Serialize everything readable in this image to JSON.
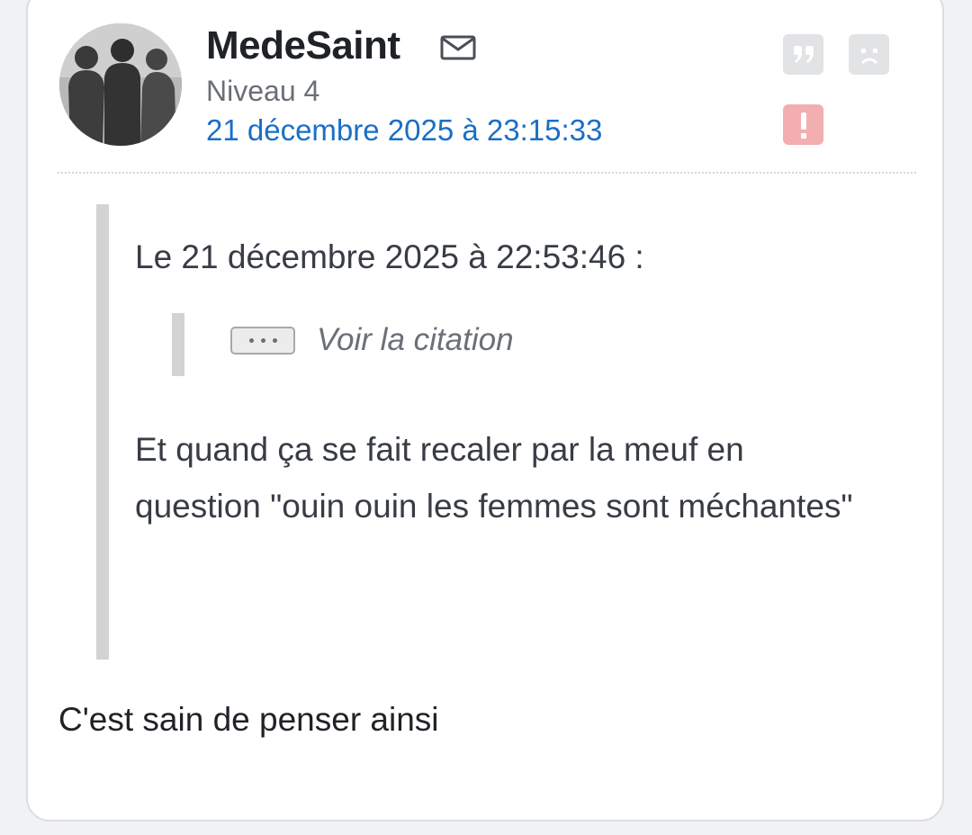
{
  "post": {
    "author": {
      "username": "MedeSaint",
      "level": "Niveau 4",
      "avatar_icon": "group-silhouette-avatar"
    },
    "date": "21 décembre 2025 à 23:15:33",
    "actions": {
      "message_icon": "envelope-icon",
      "quote_icon": "quote-icon",
      "sad_icon": "sad-face-icon",
      "report_icon": "exclamation-icon",
      "report_color": "#f3aeb0",
      "neutral_color": "#e2e3e5"
    },
    "quote": {
      "header": "Le 21 décembre 2025 à 22:53:46 :",
      "nested": {
        "expand_icon": "ellipsis-icon",
        "label": "Voir la citation"
      },
      "text": "Et quand ça se fait recaler par la meuf en question \"ouin ouin les femmes sont méchantes\""
    },
    "reply": "C'est sain de penser ainsi",
    "colors": {
      "link": "#1a6fc6",
      "quote_border": "#d3d3d3"
    }
  }
}
